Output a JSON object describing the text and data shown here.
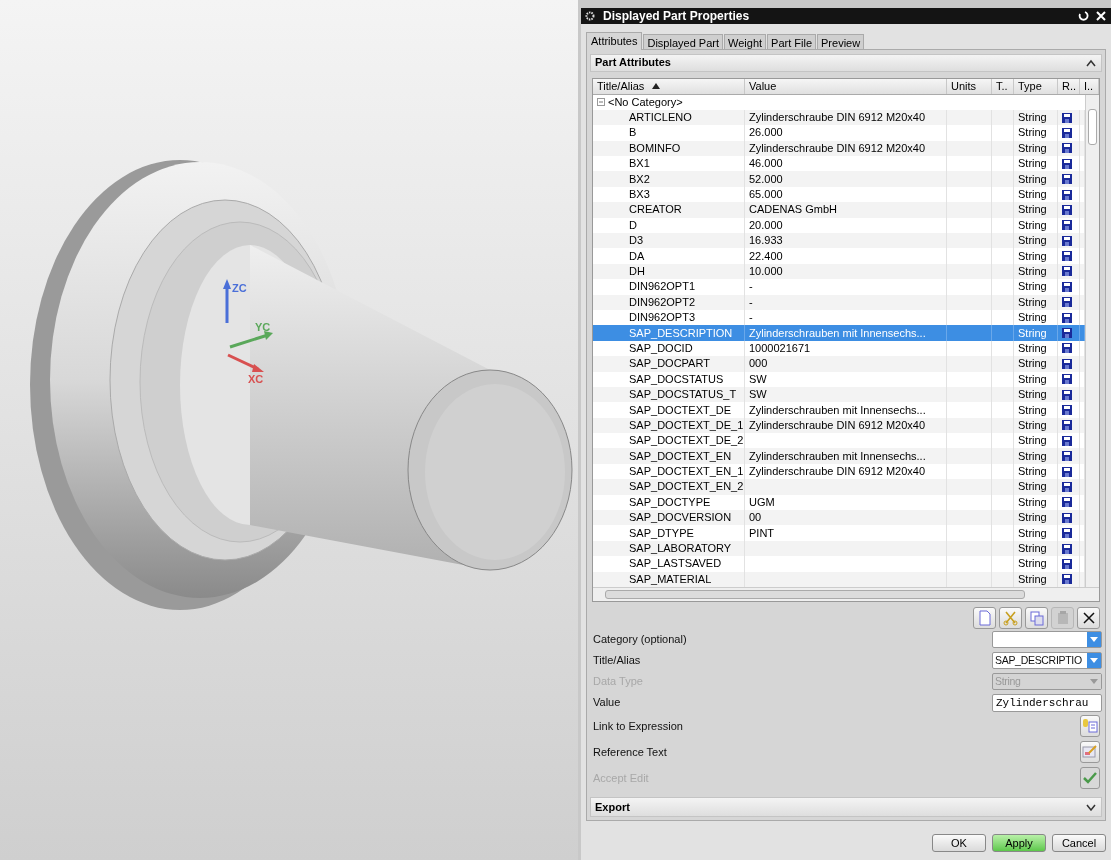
{
  "viewport": {
    "triad": [
      {
        "label": "ZC",
        "color": "#4a6fd8"
      },
      {
        "label": "YC",
        "color": "#5aa85a"
      },
      {
        "label": "XC",
        "color": "#d85050"
      }
    ]
  },
  "window": {
    "title": "Displayed Part Properties"
  },
  "tabs": [
    {
      "label": "Attributes",
      "selected": true
    },
    {
      "label": "Displayed Part",
      "selected": false
    },
    {
      "label": "Weight",
      "selected": false
    },
    {
      "label": "Part File",
      "selected": false
    },
    {
      "label": "Preview",
      "selected": false
    }
  ],
  "part_attributes": {
    "title": "Part Attributes",
    "expanded": true,
    "table": {
      "columns": [
        {
          "label": "Title/Alias",
          "sorted": true
        },
        {
          "label": "Value",
          "sorted": false
        },
        {
          "label": "Units",
          "sorted": false
        },
        {
          "label": "T..",
          "sorted": false
        },
        {
          "label": "Type",
          "sorted": false
        },
        {
          "label": "R..",
          "sorted": false
        },
        {
          "label": "I..",
          "sorted": false
        }
      ],
      "categories": [
        {
          "label": "<No Category>",
          "expanded": true,
          "children": [
            {
              "title": "ARTICLENO",
              "value": "Zylinderschraube DIN 6912 M20x40",
              "type": "String",
              "selected": false
            },
            {
              "title": "B",
              "value": "26.000",
              "type": "String",
              "selected": false
            },
            {
              "title": "BOMINFO",
              "value": "Zylinderschraube DIN 6912 M20x40",
              "type": "String",
              "selected": false
            },
            {
              "title": "BX1",
              "value": "46.000",
              "type": "String",
              "selected": false
            },
            {
              "title": "BX2",
              "value": "52.000",
              "type": "String",
              "selected": false
            },
            {
              "title": "BX3",
              "value": "65.000",
              "type": "String",
              "selected": false
            },
            {
              "title": "CREATOR",
              "value": "CADENAS GmbH",
              "type": "String",
              "selected": false
            },
            {
              "title": "D",
              "value": "20.000",
              "type": "String",
              "selected": false
            },
            {
              "title": "D3",
              "value": "16.933",
              "type": "String",
              "selected": false
            },
            {
              "title": "DA",
              "value": "22.400",
              "type": "String",
              "selected": false
            },
            {
              "title": "DH",
              "value": "10.000",
              "type": "String",
              "selected": false
            },
            {
              "title": "DIN962OPT1",
              "value": "-",
              "type": "String",
              "selected": false
            },
            {
              "title": "DIN962OPT2",
              "value": "-",
              "type": "String",
              "selected": false
            },
            {
              "title": "DIN962OPT3",
              "value": "-",
              "type": "String",
              "selected": false
            },
            {
              "title": "SAP_DESCRIPTION",
              "value": "Zylinderschrauben mit Innensechs...",
              "type": "String",
              "selected": true
            },
            {
              "title": "SAP_DOCID",
              "value": "1000021671",
              "type": "String",
              "selected": false
            },
            {
              "title": "SAP_DOCPART",
              "value": "000",
              "type": "String",
              "selected": false
            },
            {
              "title": "SAP_DOCSTATUS",
              "value": "SW",
              "type": "String",
              "selected": false
            },
            {
              "title": "SAP_DOCSTATUS_T",
              "value": "SW",
              "type": "String",
              "selected": false
            },
            {
              "title": "SAP_DOCTEXT_DE",
              "value": "Zylinderschrauben mit Innensechs...",
              "type": "String",
              "selected": false
            },
            {
              "title": "SAP_DOCTEXT_DE_1",
              "value": "Zylinderschraube DIN 6912 M20x40",
              "type": "String",
              "selected": false
            },
            {
              "title": "SAP_DOCTEXT_DE_2",
              "type": "String",
              "selected": false
            },
            {
              "title": "SAP_DOCTEXT_EN",
              "value": "Zylinderschrauben mit Innensechs...",
              "type": "String",
              "selected": false
            },
            {
              "title": "SAP_DOCTEXT_EN_1",
              "value": "Zylinderschraube DIN 6912 M20x40",
              "type": "String",
              "selected": false
            },
            {
              "title": "SAP_DOCTEXT_EN_2",
              "type": "String",
              "selected": false
            },
            {
              "title": "SAP_DOCTYPE",
              "value": "UGM",
              "type": "String",
              "selected": false
            },
            {
              "title": "SAP_DOCVERSION",
              "value": "00",
              "type": "String",
              "selected": false
            },
            {
              "title": "SAP_DTYPE",
              "value": "PINT",
              "type": "String",
              "selected": false
            },
            {
              "title": "SAP_LABORATORY",
              "type": "String",
              "selected": false
            },
            {
              "title": "SAP_LASTSAVED",
              "type": "String",
              "selected": false
            },
            {
              "title": "SAP_MATERIAL",
              "type": "String",
              "selected": false
            }
          ]
        }
      ]
    },
    "toolbar": [
      {
        "kind": "new",
        "disabled": false
      },
      {
        "kind": "cut",
        "disabled": false
      },
      {
        "kind": "copy",
        "disabled": false
      },
      {
        "kind": "paste",
        "disabled": true
      },
      {
        "kind": "delete",
        "disabled": false
      }
    ],
    "form": [
      {
        "kind": "dropdown",
        "label": "Category (optional)",
        "disabled": false
      },
      {
        "kind": "dropdown",
        "label": "Title/Alias",
        "value": "SAP_DESCRIPTIO",
        "disabled": false
      },
      {
        "kind": "dropdown",
        "label": "Data Type",
        "value": "String",
        "disabled": true
      },
      {
        "kind": "text",
        "label": "Value",
        "value": "Zylinderschrau",
        "disabled": false
      },
      {
        "kind": "expression",
        "label": "Link to Expression",
        "disabled": false
      },
      {
        "kind": "reference",
        "label": "Reference Text",
        "disabled": false
      },
      {
        "kind": "accept",
        "label": "Accept Edit",
        "disabled": true
      }
    ]
  },
  "export": {
    "title": "Export",
    "expanded": false
  },
  "buttons": [
    {
      "label": "OK",
      "highlighted": false
    },
    {
      "label": "Apply",
      "highlighted": true
    },
    {
      "label": "Cancel",
      "highlighted": false
    }
  ]
}
